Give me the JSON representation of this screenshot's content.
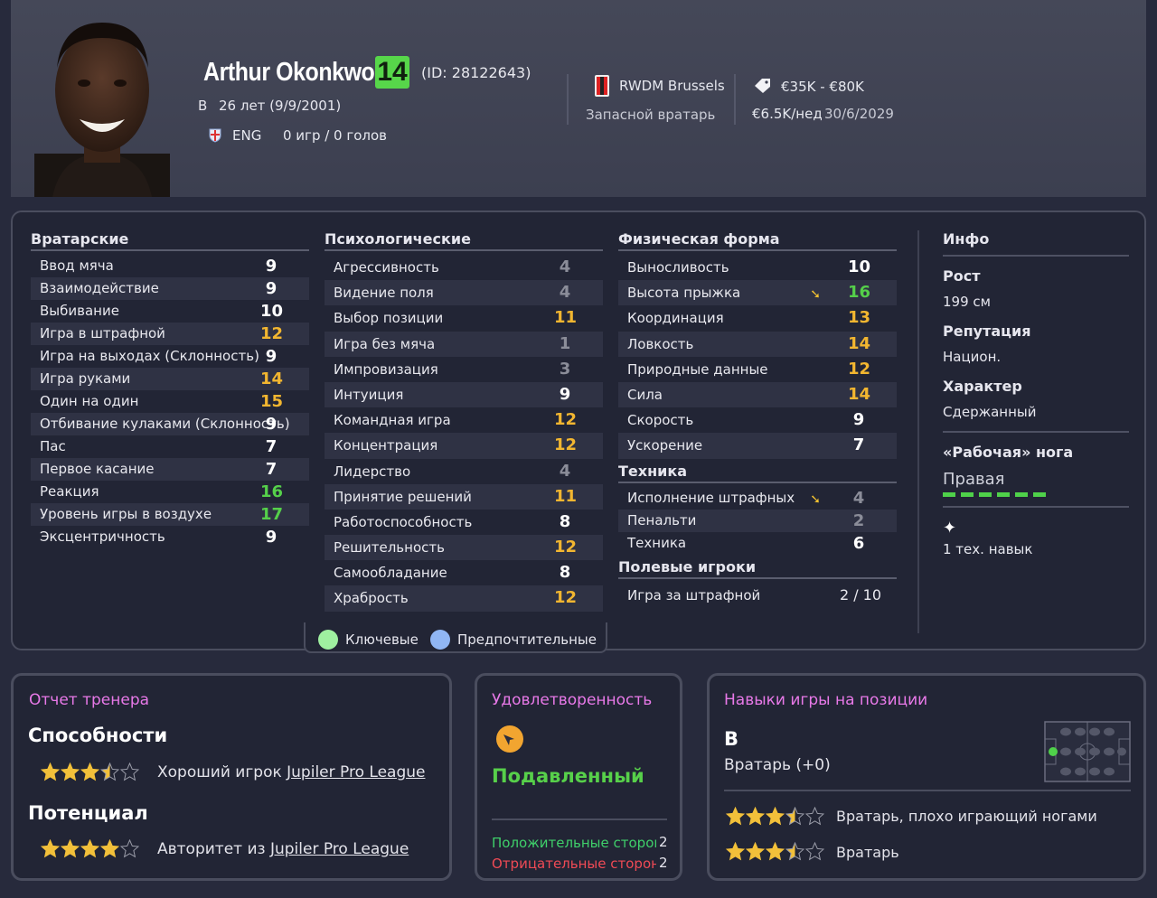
{
  "header": {
    "name": "Arthur Okonkwo",
    "ability_badge": "14",
    "player_id": "(ID: 28122643)",
    "position": "В",
    "age": "26 лет (9/9/2001)",
    "nationality": "ENG",
    "appearances": "0 игр / 0 голов",
    "club": "RWDM Brussels",
    "role": "Запасной вратарь",
    "value": "€35K - €80K",
    "wage": "€6.5K/нед",
    "contract_end": "30/6/2029",
    "colors": {
      "badge": "#57d64a",
      "accent_green": "#55d04a",
      "accent_yellow": "#f2b630"
    }
  },
  "goalkeeping": {
    "title": "Вратарские",
    "rows": [
      {
        "label": "Ввод мяча",
        "value": "9"
      },
      {
        "label": "Взаимодействие",
        "value": "9"
      },
      {
        "label": "Выбивание",
        "value": "10"
      },
      {
        "label": "Игра в штрафной",
        "value": "12"
      },
      {
        "label": "Игра на выходах (Склонность)",
        "value": "9"
      },
      {
        "label": "Игра руками",
        "value": "14"
      },
      {
        "label": "Один на один",
        "value": "15"
      },
      {
        "label": "Отбивание кулаками (Склонность)",
        "value": "9"
      },
      {
        "label": "Пас",
        "value": "7"
      },
      {
        "label": "Первое касание",
        "value": "7"
      },
      {
        "label": "Реакция",
        "value": "16"
      },
      {
        "label": "Уровень игры в воздухе",
        "value": "17"
      },
      {
        "label": "Эксцентричность",
        "value": "9"
      }
    ]
  },
  "mental": {
    "title": "Психологические",
    "rows": [
      {
        "label": "Агрессивность",
        "value": "4"
      },
      {
        "label": "Видение поля",
        "value": "4"
      },
      {
        "label": "Выбор позиции",
        "value": "11"
      },
      {
        "label": "Игра без мяча",
        "value": "1"
      },
      {
        "label": "Импровизация",
        "value": "3"
      },
      {
        "label": "Интуиция",
        "value": "9"
      },
      {
        "label": "Командная игра",
        "value": "12"
      },
      {
        "label": "Концентрация",
        "value": "12"
      },
      {
        "label": "Лидерство",
        "value": "4"
      },
      {
        "label": "Принятие решений",
        "value": "11"
      },
      {
        "label": "Работоспособность",
        "value": "8"
      },
      {
        "label": "Решительность",
        "value": "12"
      },
      {
        "label": "Самообладание",
        "value": "8"
      },
      {
        "label": "Храбрость",
        "value": "12"
      }
    ]
  },
  "physical": {
    "title": "Физическая форма",
    "rows": [
      {
        "label": "Выносливость",
        "value": "10"
      },
      {
        "label": "Высота прыжка",
        "value": "16"
      },
      {
        "label": "Координация",
        "value": "13"
      },
      {
        "label": "Ловкость",
        "value": "14"
      },
      {
        "label": "Природные данные",
        "value": "12"
      },
      {
        "label": "Сила",
        "value": "14"
      },
      {
        "label": "Скорость",
        "value": "9"
      },
      {
        "label": "Ускорение",
        "value": "7"
      }
    ]
  },
  "technique": {
    "title": "Техника",
    "rows": [
      {
        "label": "Исполнение штрафных",
        "value": "4"
      },
      {
        "label": "Пенальти",
        "value": "2"
      },
      {
        "label": "Техника",
        "value": "6"
      }
    ]
  },
  "outfield": {
    "title": "Полевые игроки",
    "rows": [
      {
        "label": "Игра за штрафной",
        "value": "2 / 10"
      }
    ]
  },
  "info": {
    "title": "Инфо",
    "height_label": "Рост",
    "height": "199 см",
    "reputation_label": "Репутация",
    "reputation": "Национ.",
    "personality_label": "Характер",
    "personality": "Сдержанный",
    "foot_label": "«Рабочая» нога",
    "foot": "Правая",
    "traits": "1 тех. навык"
  },
  "legend": {
    "key": "Ключевые",
    "preferred": "Предпочтительные"
  },
  "coach_report": {
    "title": "Отчет тренера",
    "ability_head": "Способности",
    "ability_stars": 3.5,
    "ability_text": "Хороший игрок ",
    "ability_league": "Jupiler Pro League",
    "potential_head": "Потенциал",
    "potential_stars": 4,
    "potential_text": "Авторитет из ",
    "potential_league": "Jupiler Pro League"
  },
  "morale": {
    "title": "Удовлетворенность",
    "state": "Подавленный",
    "positive": "Положительные стороны",
    "positive_count": "2",
    "negative": "Отрицательные стороны",
    "negative_count": "2"
  },
  "positions": {
    "title": "Навыки игры на позиции",
    "code": "В",
    "name": "Вратарь (+0)",
    "roles": [
      {
        "name": "Вратарь, плохо играющий ногами",
        "stars": 3.5
      },
      {
        "name": "Вратарь",
        "stars": 3.5
      }
    ]
  }
}
